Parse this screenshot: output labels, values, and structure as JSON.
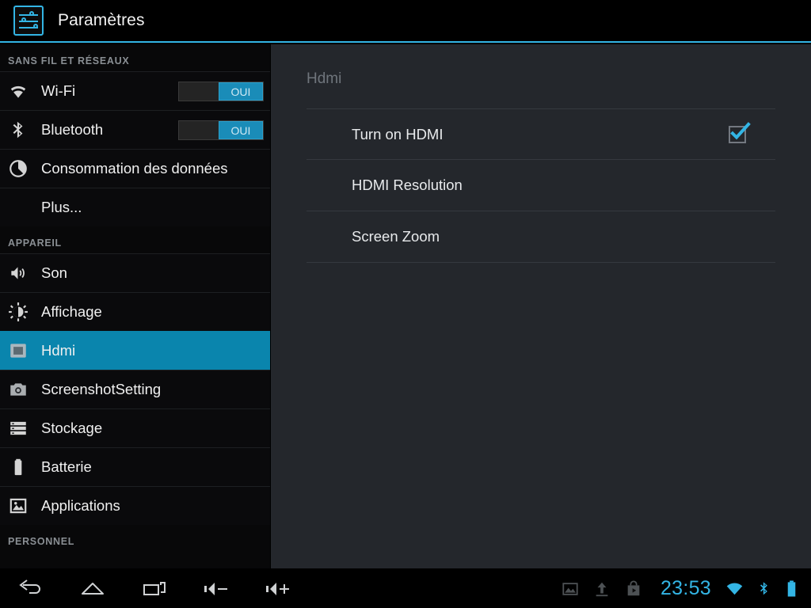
{
  "titlebar": {
    "app_icon": "settings-sliders-icon",
    "title": "Paramètres",
    "accent_color": "#33b5e5"
  },
  "sidebar": {
    "selected_color": "#0a85ad",
    "toggle_on_color": "#1a8cb8",
    "groups": [
      {
        "header": "SANS FIL ET RÉSEAUX",
        "items": [
          {
            "label": "Wi-Fi",
            "icon": "wifi-icon",
            "toggle": "OUI",
            "selected": false
          },
          {
            "label": "Bluetooth",
            "icon": "bluetooth-icon",
            "toggle": "OUI",
            "selected": false
          },
          {
            "label": "Consommation des données",
            "icon": "data-usage-icon",
            "selected": false
          },
          {
            "label": "Plus...",
            "icon": null,
            "selected": false
          }
        ]
      },
      {
        "header": "APPAREIL",
        "items": [
          {
            "label": "Son",
            "icon": "sound-icon",
            "selected": false
          },
          {
            "label": "Affichage",
            "icon": "display-brightness-icon",
            "selected": false
          },
          {
            "label": "Hdmi",
            "icon": "hdmi-monitor-icon",
            "selected": true
          },
          {
            "label": "ScreenshotSetting",
            "icon": "camera-icon",
            "selected": false
          },
          {
            "label": "Stockage",
            "icon": "storage-icon",
            "selected": false
          },
          {
            "label": "Batterie",
            "icon": "battery-icon",
            "selected": false
          },
          {
            "label": "Applications",
            "icon": "applications-icon",
            "selected": false
          }
        ]
      },
      {
        "header": "PERSONNEL",
        "items": []
      }
    ]
  },
  "content": {
    "title": "Hdmi",
    "preferences": [
      {
        "label": "Turn on HDMI",
        "control": "checkbox",
        "checked": true
      },
      {
        "label": "HDMI Resolution",
        "control": "none"
      },
      {
        "label": "Screen Zoom",
        "control": "none"
      }
    ]
  },
  "system_bar": {
    "nav_buttons": [
      {
        "name": "back-icon"
      },
      {
        "name": "home-icon"
      },
      {
        "name": "recents-icon"
      },
      {
        "name": "volume-down-icon"
      },
      {
        "name": "volume-up-icon"
      }
    ],
    "status_icons": [
      {
        "name": "screenshot-image-icon"
      },
      {
        "name": "upload-icon"
      },
      {
        "name": "play-store-icon"
      }
    ],
    "clock": "23:53",
    "clock_color": "#33b5e5",
    "right_icons": [
      {
        "name": "wifi-status-icon"
      },
      {
        "name": "bluetooth-status-icon"
      },
      {
        "name": "battery-status-icon"
      }
    ]
  }
}
